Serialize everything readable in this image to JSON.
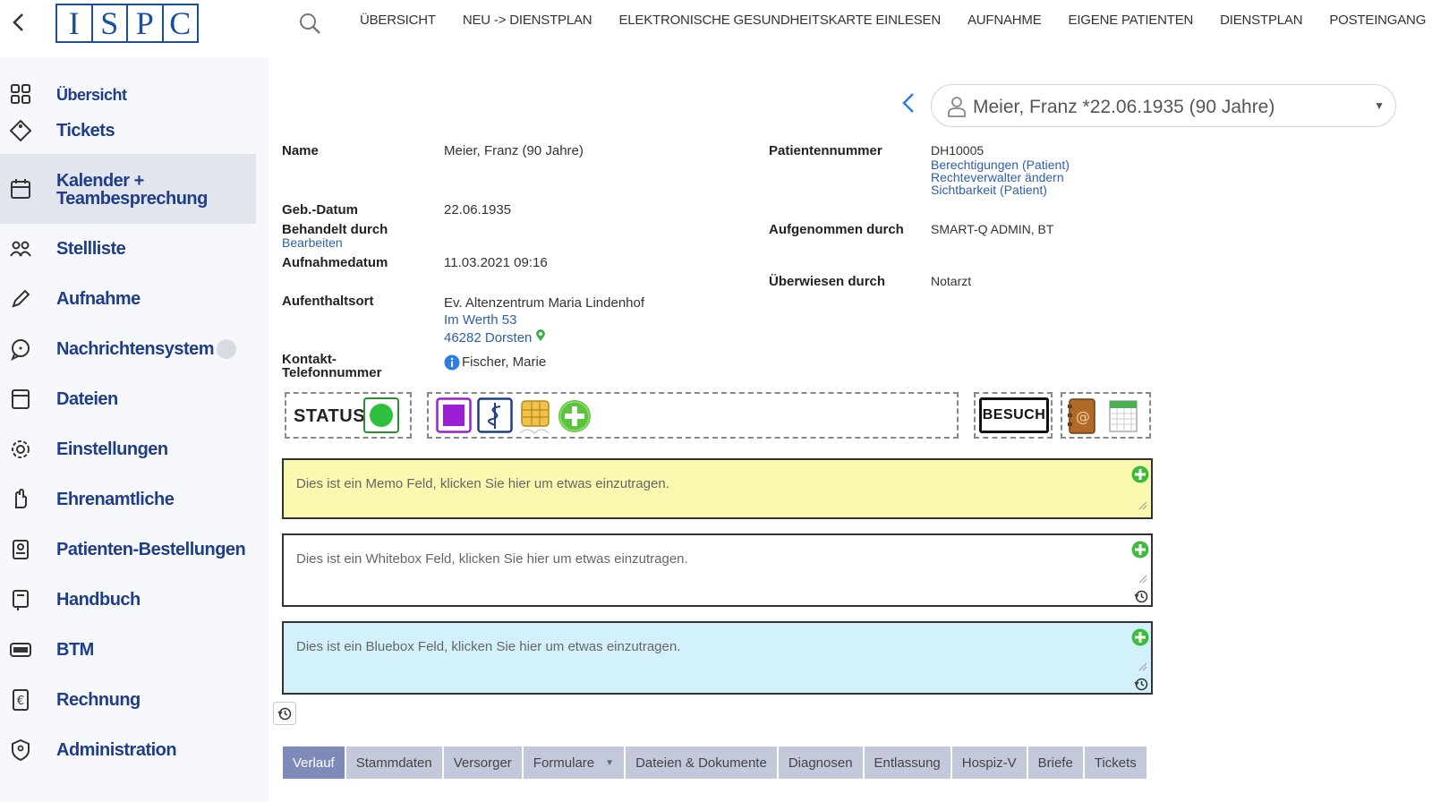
{
  "logo": {
    "letters": [
      "I",
      "S",
      "P",
      "C"
    ]
  },
  "topnav": [
    "ÜBERSICHT",
    "NEU -> DIENSTPLAN",
    "ELEKTRONISCHE GESUNDHEITSKARTE EINLESEN",
    "AUFNAHME",
    "EIGENE PATIENTEN",
    "DIENSTPLAN",
    "POSTEINGANG"
  ],
  "sidebar": {
    "items": [
      {
        "label": "Übersicht",
        "icon": "grid-icon"
      },
      {
        "label": "Tickets",
        "icon": "ticket-icon"
      },
      {
        "label": "Kalender +",
        "label2": "Teambesprechung",
        "icon": "calendar-icon"
      },
      {
        "label": "Stellliste",
        "icon": "people-icon"
      },
      {
        "label": "Aufnahme",
        "icon": "pencil-icon"
      },
      {
        "label": "Nachrichtensystem",
        "icon": "chat-icon"
      },
      {
        "label": "Dateien",
        "icon": "file-icon"
      },
      {
        "label": "Einstellungen",
        "icon": "gear-icon"
      },
      {
        "label": "Ehrenamtliche",
        "icon": "hand-icon"
      },
      {
        "label": "Patienten-Bestellungen",
        "icon": "order-icon"
      },
      {
        "label": "Handbuch",
        "icon": "book-icon"
      },
      {
        "label": "BTM",
        "icon": "btm-icon"
      },
      {
        "label": "Rechnung",
        "icon": "invoice-icon"
      },
      {
        "label": "Administration",
        "icon": "shield-icon"
      }
    ]
  },
  "patient_selector": {
    "value": "Meier, Franz *22.06.1935 (90 Jahre)"
  },
  "patient": {
    "name_label": "Name",
    "name_value": "Meier, Franz (90 Jahre)",
    "geb_label": "Geb.-Datum",
    "geb_value": "22.06.1935",
    "behandelt_label": "Behandelt durch",
    "bearbeiten_link": "Bearbeiten",
    "aufnahmedatum_label": "Aufnahmedatum",
    "aufnahmedatum_value": "11.03.2021 09:16",
    "aufenthalt_label": "Aufenthaltsort",
    "aufenthalt_line1": "Ev. Altenzentrum Maria Lindenhof",
    "aufenthalt_line2": "Im Werth 53",
    "aufenthalt_line3": "46282 Dorsten",
    "kontakt_label1": "Kontakt-",
    "kontakt_label2": "Telefonnummer",
    "kontakt_value": "Fischer, Marie",
    "patnr_label": "Patientennummer",
    "patnr_value": "DH10005",
    "link_berechtigungen": "Berechtigungen (Patient)",
    "link_rechteverwalter": "Rechteverwalter ändern",
    "link_sichtbarkeit": "Sichtbarkeit (Patient)",
    "aufgenommen_label": "Aufgenommen durch",
    "aufgenommen_value": "SMART-Q ADMIN, BT",
    "ueberwiesen_label": "Überwiesen durch",
    "ueberwiesen_value": "Notarzt"
  },
  "toolbar": {
    "status_label": "STATUS",
    "status_color": "#2fbf3a",
    "besuch_label": "BESUCH"
  },
  "memos": {
    "memo_placeholder": "Dies ist ein Memo Feld, klicken Sie hier um etwas einzutragen.",
    "whitebox_placeholder": "Dies ist ein Whitebox Feld, klicken Sie hier um etwas einzutragen.",
    "bluebox_placeholder": "Dies ist ein Bluebox Feld, klicken Sie hier um etwas einzutragen.",
    "memo_color": "#fbf9b0",
    "bluebox_color": "#d3f1fb"
  },
  "tabs": [
    {
      "label": "Verlauf",
      "active": true
    },
    {
      "label": "Stammdaten"
    },
    {
      "label": "Versorger"
    },
    {
      "label": "Formulare",
      "dropdown": true
    },
    {
      "label": "Dateien & Dokumente"
    },
    {
      "label": "Diagnosen"
    },
    {
      "label": "Entlassung"
    },
    {
      "label": "Hospiz-V"
    },
    {
      "label": "Briefe"
    },
    {
      "label": "Tickets"
    }
  ]
}
